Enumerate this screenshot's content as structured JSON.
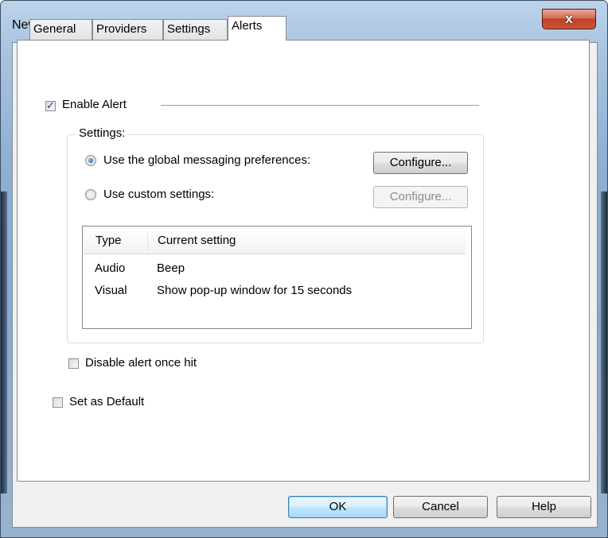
{
  "window": {
    "title": "News Filter",
    "close_glyph": "x"
  },
  "tabs": [
    {
      "label": "General",
      "active": false
    },
    {
      "label": "Providers",
      "active": false
    },
    {
      "label": "Settings",
      "active": false
    },
    {
      "label": "Alerts",
      "active": true
    }
  ],
  "alerts": {
    "enable_alert": {
      "label": "Enable Alert",
      "checked": true
    },
    "settings_group": {
      "title": "Settings:",
      "global_option": {
        "label": "Use the global messaging preferences:",
        "selected": true
      },
      "custom_option": {
        "label": "Use custom settings:",
        "selected": false
      },
      "configure_global_label": "Configure...",
      "configure_custom_label": "Configure...",
      "table": {
        "columns": [
          "Type",
          "Current setting"
        ],
        "rows": [
          [
            "Audio",
            "Beep"
          ],
          [
            "Visual",
            "Show pop-up window for 15 seconds"
          ]
        ]
      }
    },
    "disable_once_hit": {
      "label": "Disable alert once hit",
      "checked": false
    },
    "set_as_default": {
      "label": "Set as Default",
      "checked": false
    }
  },
  "footer": {
    "ok_label": "OK",
    "cancel_label": "Cancel",
    "help_label": "Help"
  }
}
